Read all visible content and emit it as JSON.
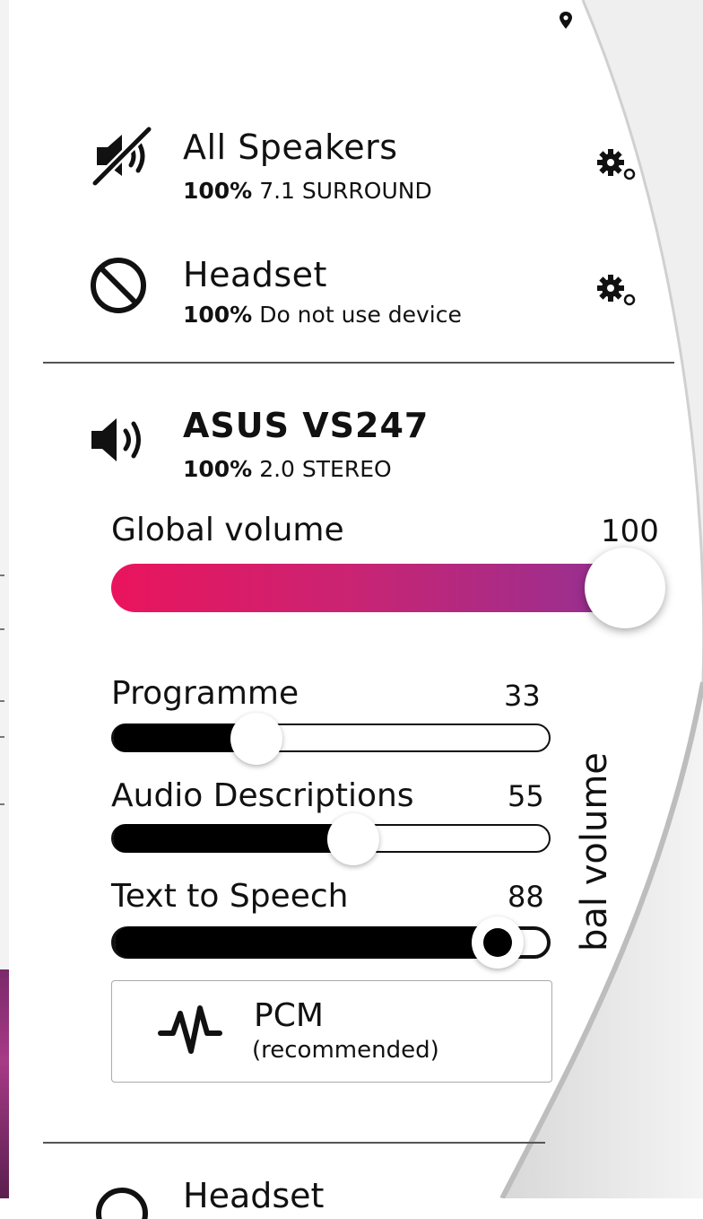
{
  "devices": [
    {
      "name": "All Speakers",
      "percent": "100%",
      "mode": "7.1 SURROUND",
      "icon": "speaker-muted-icon"
    },
    {
      "name": "Headset",
      "percent": "100%",
      "mode": "Do not use device",
      "icon": "block-icon"
    },
    {
      "name": "ASUS VS247",
      "percent": "100%",
      "mode": "2.0 STEREO",
      "icon": "speaker-icon"
    }
  ],
  "global_volume": {
    "label": "Global volume",
    "value": "100",
    "level_percent": 100
  },
  "channels": [
    {
      "label": "Programme",
      "value": "33",
      "level_percent": 33
    },
    {
      "label": "Audio Descriptions",
      "value": "55",
      "level_percent": 55
    },
    {
      "label": "Text to Speech",
      "value": "88",
      "level_percent": 88
    }
  ],
  "format": {
    "title": "PCM",
    "subtitle": "(recommended)",
    "icon": "waveform-icon"
  },
  "next_device": {
    "name": "Headset"
  },
  "side_label": "bal volume",
  "colors": {
    "gradient_start": "#ea145d",
    "gradient_end": "#9a2f8f",
    "fill": "#000000"
  }
}
